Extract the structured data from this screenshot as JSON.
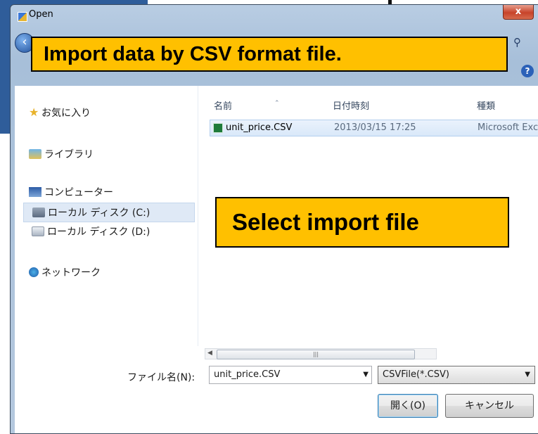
{
  "window": {
    "title": "Open",
    "close_label": "x"
  },
  "annotations": {
    "import_note": "Import data by CSV format file.",
    "select_note": "Select import file"
  },
  "nav": {
    "items": [
      {
        "label": "お気に入り",
        "icon": "star-icon"
      },
      {
        "label": "ライブラリ",
        "icon": "library-icon"
      },
      {
        "label": "コンピューター",
        "icon": "computer-icon"
      },
      {
        "label": "ローカル ディスク (C:)",
        "icon": "drive-icon"
      },
      {
        "label": "ローカル ディスク (D:)",
        "icon": "drive-icon"
      },
      {
        "label": "ネットワーク",
        "icon": "network-icon"
      }
    ]
  },
  "list": {
    "columns": [
      "名前",
      "日付時刻",
      "種類"
    ],
    "files": [
      {
        "name": "unit_price.CSV",
        "date": "2013/03/15 17:25",
        "type": "Microsoft Exc",
        "icon": "excel-file-icon"
      }
    ]
  },
  "bottom": {
    "filename_label": "ファイル名(N):",
    "filename_value": "unit_price.CSV",
    "filetype_value": "CSVFile(*.CSV)",
    "open_label": "開く(O)",
    "cancel_label": "キャンセル"
  },
  "colors": {
    "callout": "#ffc000",
    "titlebar": "#b9cde3",
    "selection": "#d9e8f9"
  }
}
